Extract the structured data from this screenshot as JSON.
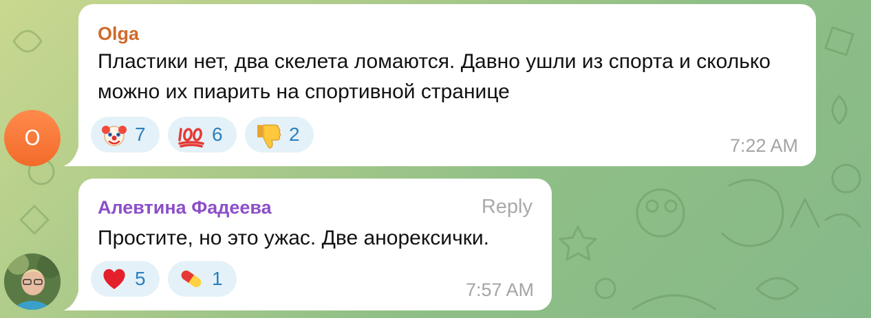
{
  "messages": [
    {
      "sender": "Olga",
      "avatar_letter": "O",
      "text": "Пластики нет, два скелета ломаются. Давно ушли из спорта и сколько можно их пиарить на спортивной странице",
      "reactions": [
        {
          "emoji": "clown-face-icon",
          "count": "7"
        },
        {
          "emoji": "hundred-points-icon",
          "count": "6"
        },
        {
          "emoji": "thumbs-down-icon",
          "count": "2"
        }
      ],
      "time": "7:22 AM"
    },
    {
      "sender": "Алевтина Фадеева",
      "reply_label": "Reply",
      "text": "Простите, но это ужас. Две анорексички.",
      "reactions": [
        {
          "emoji": "red-heart-icon",
          "count": "5"
        },
        {
          "emoji": "pill-icon",
          "count": "1"
        }
      ],
      "time": "7:57 AM"
    }
  ],
  "colors": {
    "sender_1": "#cf6a2a",
    "sender_2": "#8c4fc8",
    "reaction_bg": "#e4f1f8",
    "reaction_count": "#2a7fbf",
    "time": "#a4a4a4",
    "avatar_orange": "#f26b2a"
  }
}
